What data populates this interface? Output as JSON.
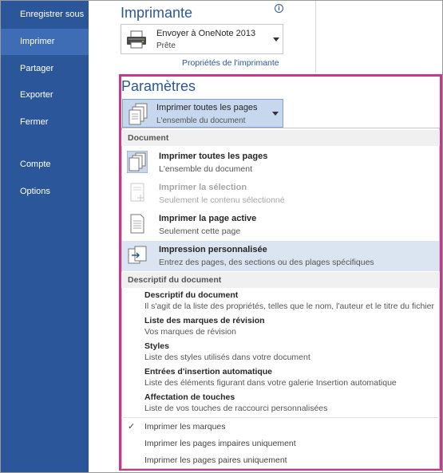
{
  "nav": {
    "items": [
      {
        "label": "Enregistrer sous"
      },
      {
        "label": "Imprimer"
      },
      {
        "label": "Partager"
      },
      {
        "label": "Exporter"
      },
      {
        "label": "Fermer"
      },
      {
        "label": "Compte"
      },
      {
        "label": "Options"
      }
    ]
  },
  "printer": {
    "section_title": "Imprimante",
    "name": "Envoyer à OneNote 2013",
    "status": "Prête",
    "properties_link": "Propriétés de l'imprimante"
  },
  "settings": {
    "section_title": "Paramètres",
    "selected": {
      "title": "Imprimer toutes les pages",
      "subtitle": "L'ensemble du document"
    }
  },
  "dropdown": {
    "document_header": "Document",
    "options": [
      {
        "title": "Imprimer toutes les pages",
        "subtitle": "L'ensemble du document",
        "icon": "pages-icon",
        "state": "normal"
      },
      {
        "title": "Imprimer la sélection",
        "subtitle": "Seulement le contenu sélectionné",
        "icon": "selection-icon",
        "state": "disabled"
      },
      {
        "title": "Imprimer la page active",
        "subtitle": "Seulement cette page",
        "icon": "page-icon",
        "state": "normal"
      },
      {
        "title": "Impression personnalisée",
        "subtitle": "Entrez des pages, des sections ou des plages spécifiques",
        "icon": "custom-print-icon",
        "state": "hover"
      }
    ],
    "info_header": "Descriptif du document",
    "info_items": [
      {
        "title": "Descriptif du document",
        "text": "Il s'agit de la liste des propriétés, telles que le nom, l'auteur et le titre du fichier"
      },
      {
        "title": "Liste des marques de révision",
        "text": "Vos marques de révision"
      },
      {
        "title": "Styles",
        "text": "Liste des styles utilisés dans votre document"
      },
      {
        "title": "Entrées d'insertion automatique",
        "text": "Liste des éléments figurant dans votre galerie Insertion automatique"
      },
      {
        "title": "Affectation de touches",
        "text": "Liste de vos touches de raccourci personnalisées"
      }
    ],
    "toggles": [
      {
        "label": "Imprimer les marques",
        "checked": true
      },
      {
        "label": "Imprimer les pages impaires uniquement",
        "checked": false
      },
      {
        "label": "Imprimer les pages paires uniquement",
        "checked": false
      }
    ],
    "check_glyph": "✓"
  },
  "colors": {
    "sidebar": "#2b579a",
    "sidebar_active": "#3e6db5",
    "accent": "#2b579a",
    "highlight_border": "#c8368f",
    "hover_row": "#dbe4f1"
  }
}
